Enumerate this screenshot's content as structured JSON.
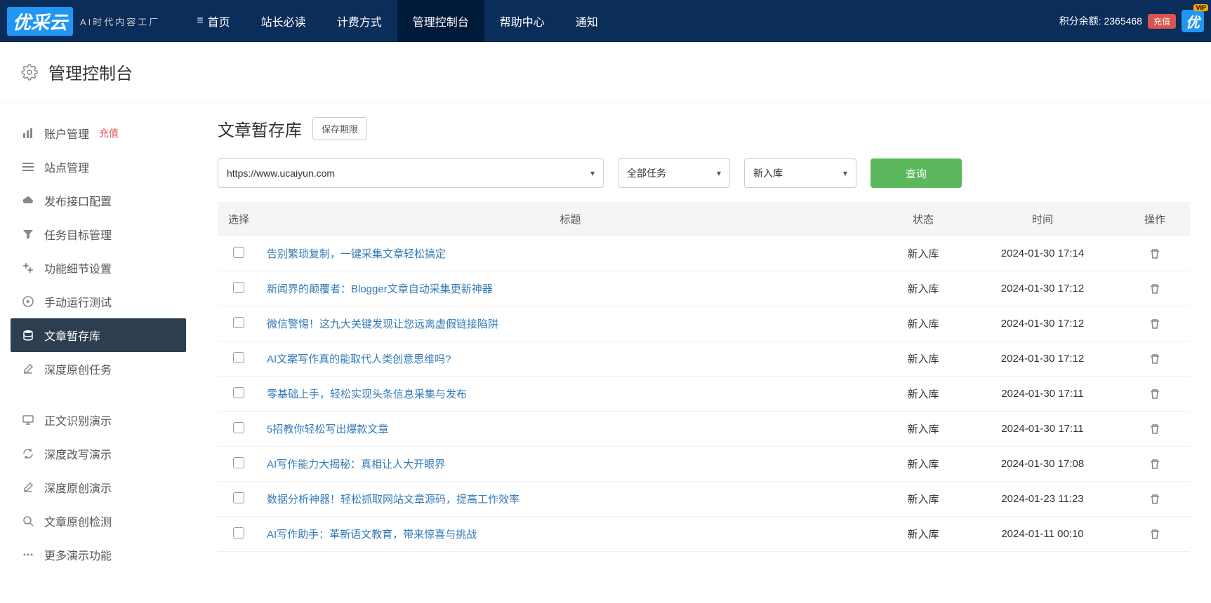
{
  "header": {
    "logo_text": "优采云",
    "logo_sub": "AI时代内容工厂",
    "nav": [
      {
        "label": "首页",
        "icon": "menu"
      },
      {
        "label": "站长必读"
      },
      {
        "label": "计费方式"
      },
      {
        "label": "管理控制台",
        "active": true
      },
      {
        "label": "帮助中心"
      },
      {
        "label": "通知"
      }
    ],
    "points_label": "积分余额:",
    "points_value": "2365468",
    "recharge": "充值"
  },
  "page_title": "管理控制台",
  "sidebar": {
    "items": [
      {
        "icon": "bar-chart",
        "label": "账户管理",
        "badge": "充值"
      },
      {
        "icon": "list",
        "label": "站点管理"
      },
      {
        "icon": "cloud",
        "label": "发布接口配置"
      },
      {
        "icon": "filter",
        "label": "任务目标管理"
      },
      {
        "icon": "cogs",
        "label": "功能细节设置"
      },
      {
        "icon": "play",
        "label": "手动运行测试"
      },
      {
        "icon": "database",
        "label": "文章暂存库",
        "active": true
      },
      {
        "icon": "edit",
        "label": "深度原创任务"
      }
    ],
    "items2": [
      {
        "icon": "desktop",
        "label": "正文识别演示"
      },
      {
        "icon": "refresh",
        "label": "深度改写演示"
      },
      {
        "icon": "edit",
        "label": "深度原创演示"
      },
      {
        "icon": "search",
        "label": "文章原创检测"
      },
      {
        "icon": "dots",
        "label": "更多演示功能"
      }
    ]
  },
  "main": {
    "title": "文章暂存库",
    "retention_btn": "保存期限",
    "filters": {
      "url": "https://www.ucaiyun.com",
      "task": "全部任务",
      "status": "新入库",
      "query_btn": "查询"
    },
    "columns": {
      "select": "选择",
      "title": "标题",
      "status": "状态",
      "time": "时间",
      "action": "操作"
    },
    "rows": [
      {
        "title": "告别繁琐复制，一键采集文章轻松搞定",
        "status": "新入库",
        "time": "2024-01-30 17:14"
      },
      {
        "title": "新闻界的颠覆者：Blogger文章自动采集更新神器",
        "status": "新入库",
        "time": "2024-01-30 17:12"
      },
      {
        "title": "微信警惕！这九大关键发现让您远离虚假链接陷阱",
        "status": "新入库",
        "time": "2024-01-30 17:12"
      },
      {
        "title": "AI文案写作真的能取代人类创意思维吗?",
        "status": "新入库",
        "time": "2024-01-30 17:12"
      },
      {
        "title": "零基础上手，轻松实现头条信息采集与发布",
        "status": "新入库",
        "time": "2024-01-30 17:11"
      },
      {
        "title": "5招教你轻松写出爆款文章",
        "status": "新入库",
        "time": "2024-01-30 17:11"
      },
      {
        "title": "AI写作能力大揭秘：真相让人大开眼界",
        "status": "新入库",
        "time": "2024-01-30 17:08"
      },
      {
        "title": "数据分析神器！轻松抓取网站文章源码，提高工作效率",
        "status": "新入库",
        "time": "2024-01-23 11:23"
      },
      {
        "title": "AI写作助手：革新语文教育，带来惊喜与挑战",
        "status": "新入库",
        "time": "2024-01-11 00:10"
      }
    ]
  }
}
